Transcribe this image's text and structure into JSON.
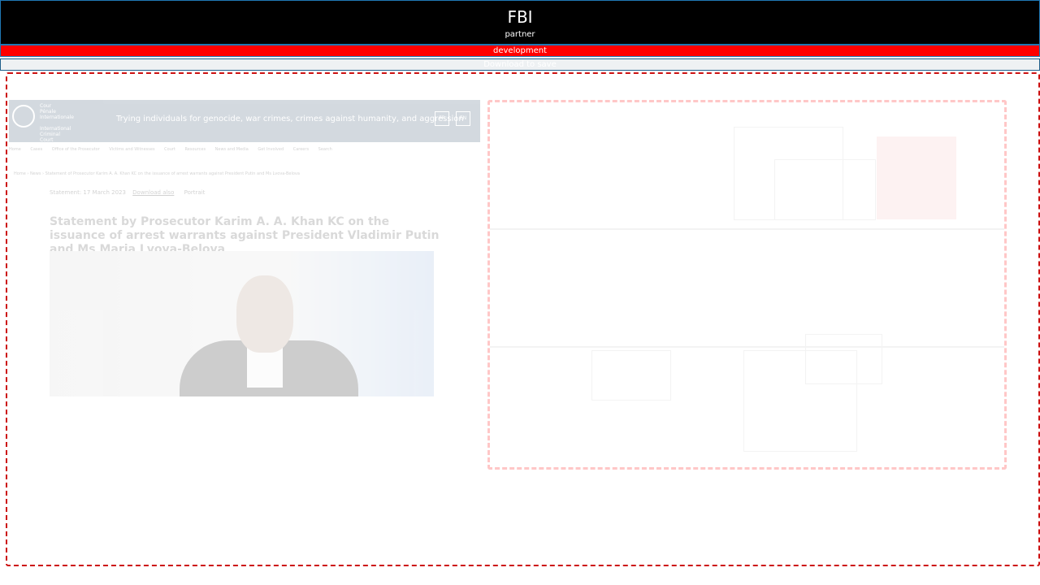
{
  "header": {
    "title": "FBI",
    "subtitle": "partner"
  },
  "banner": {
    "label": "development"
  },
  "subbanner": {
    "label": "Download to save"
  },
  "preview": {
    "site": {
      "logo_text": "Cour\nPénale\nInternationale\n\nInternational\nCriminal\nCourt",
      "tagline": "Trying individuals for genocide, war crimes, crimes against humanity, and aggression",
      "lang_buttons": [
        "FR",
        "EN"
      ],
      "nav_items": [
        "Home",
        "Cases",
        "Office of the Prosecutor",
        "Victims and Witnesses",
        "Court",
        "Resources",
        "News and Media",
        "Get Involved",
        "Careers",
        "Search"
      ],
      "breadcrumb": "Home › News › Statement of Prosecutor Karim A. A. Khan KC on the issuance of arrest warrants against President Putin and Ms Lvova-Belova"
    },
    "article": {
      "date": "Statement: 17 March 2023",
      "download_label": "Download also",
      "type_label": "Portrait",
      "headline": "Statement by Prosecutor Karim A. A. Khan KC on the issuance of arrest warrants against President Vladimir Putin and Ms Maria Lvova-Belova"
    }
  },
  "colors": {
    "header_bg": "#000000",
    "banner_bg": "#ff0000",
    "frame_border": "#cc1111",
    "panel_border": "#ffc7c7"
  }
}
